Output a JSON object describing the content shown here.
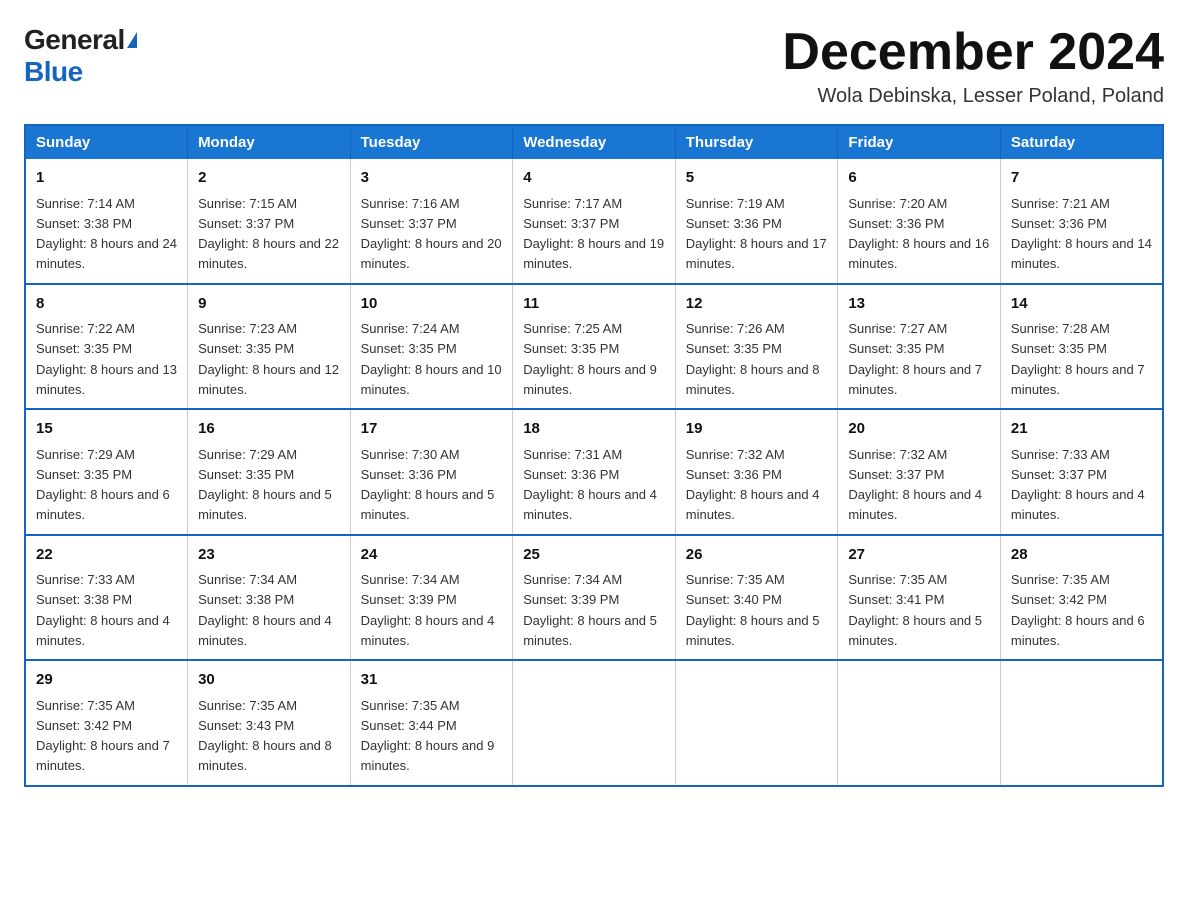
{
  "header": {
    "logo_general": "General",
    "logo_blue": "Blue",
    "month_title": "December 2024",
    "location": "Wola Debinska, Lesser Poland, Poland"
  },
  "days_of_week": [
    "Sunday",
    "Monday",
    "Tuesday",
    "Wednesday",
    "Thursday",
    "Friday",
    "Saturday"
  ],
  "weeks": [
    [
      {
        "day": "1",
        "sunrise": "7:14 AM",
        "sunset": "3:38 PM",
        "daylight": "8 hours and 24 minutes."
      },
      {
        "day": "2",
        "sunrise": "7:15 AM",
        "sunset": "3:37 PM",
        "daylight": "8 hours and 22 minutes."
      },
      {
        "day": "3",
        "sunrise": "7:16 AM",
        "sunset": "3:37 PM",
        "daylight": "8 hours and 20 minutes."
      },
      {
        "day": "4",
        "sunrise": "7:17 AM",
        "sunset": "3:37 PM",
        "daylight": "8 hours and 19 minutes."
      },
      {
        "day": "5",
        "sunrise": "7:19 AM",
        "sunset": "3:36 PM",
        "daylight": "8 hours and 17 minutes."
      },
      {
        "day": "6",
        "sunrise": "7:20 AM",
        "sunset": "3:36 PM",
        "daylight": "8 hours and 16 minutes."
      },
      {
        "day": "7",
        "sunrise": "7:21 AM",
        "sunset": "3:36 PM",
        "daylight": "8 hours and 14 minutes."
      }
    ],
    [
      {
        "day": "8",
        "sunrise": "7:22 AM",
        "sunset": "3:35 PM",
        "daylight": "8 hours and 13 minutes."
      },
      {
        "day": "9",
        "sunrise": "7:23 AM",
        "sunset": "3:35 PM",
        "daylight": "8 hours and 12 minutes."
      },
      {
        "day": "10",
        "sunrise": "7:24 AM",
        "sunset": "3:35 PM",
        "daylight": "8 hours and 10 minutes."
      },
      {
        "day": "11",
        "sunrise": "7:25 AM",
        "sunset": "3:35 PM",
        "daylight": "8 hours and 9 minutes."
      },
      {
        "day": "12",
        "sunrise": "7:26 AM",
        "sunset": "3:35 PM",
        "daylight": "8 hours and 8 minutes."
      },
      {
        "day": "13",
        "sunrise": "7:27 AM",
        "sunset": "3:35 PM",
        "daylight": "8 hours and 7 minutes."
      },
      {
        "day": "14",
        "sunrise": "7:28 AM",
        "sunset": "3:35 PM",
        "daylight": "8 hours and 7 minutes."
      }
    ],
    [
      {
        "day": "15",
        "sunrise": "7:29 AM",
        "sunset": "3:35 PM",
        "daylight": "8 hours and 6 minutes."
      },
      {
        "day": "16",
        "sunrise": "7:29 AM",
        "sunset": "3:35 PM",
        "daylight": "8 hours and 5 minutes."
      },
      {
        "day": "17",
        "sunrise": "7:30 AM",
        "sunset": "3:36 PM",
        "daylight": "8 hours and 5 minutes."
      },
      {
        "day": "18",
        "sunrise": "7:31 AM",
        "sunset": "3:36 PM",
        "daylight": "8 hours and 4 minutes."
      },
      {
        "day": "19",
        "sunrise": "7:32 AM",
        "sunset": "3:36 PM",
        "daylight": "8 hours and 4 minutes."
      },
      {
        "day": "20",
        "sunrise": "7:32 AM",
        "sunset": "3:37 PM",
        "daylight": "8 hours and 4 minutes."
      },
      {
        "day": "21",
        "sunrise": "7:33 AM",
        "sunset": "3:37 PM",
        "daylight": "8 hours and 4 minutes."
      }
    ],
    [
      {
        "day": "22",
        "sunrise": "7:33 AM",
        "sunset": "3:38 PM",
        "daylight": "8 hours and 4 minutes."
      },
      {
        "day": "23",
        "sunrise": "7:34 AM",
        "sunset": "3:38 PM",
        "daylight": "8 hours and 4 minutes."
      },
      {
        "day": "24",
        "sunrise": "7:34 AM",
        "sunset": "3:39 PM",
        "daylight": "8 hours and 4 minutes."
      },
      {
        "day": "25",
        "sunrise": "7:34 AM",
        "sunset": "3:39 PM",
        "daylight": "8 hours and 5 minutes."
      },
      {
        "day": "26",
        "sunrise": "7:35 AM",
        "sunset": "3:40 PM",
        "daylight": "8 hours and 5 minutes."
      },
      {
        "day": "27",
        "sunrise": "7:35 AM",
        "sunset": "3:41 PM",
        "daylight": "8 hours and 5 minutes."
      },
      {
        "day": "28",
        "sunrise": "7:35 AM",
        "sunset": "3:42 PM",
        "daylight": "8 hours and 6 minutes."
      }
    ],
    [
      {
        "day": "29",
        "sunrise": "7:35 AM",
        "sunset": "3:42 PM",
        "daylight": "8 hours and 7 minutes."
      },
      {
        "day": "30",
        "sunrise": "7:35 AM",
        "sunset": "3:43 PM",
        "daylight": "8 hours and 8 minutes."
      },
      {
        "day": "31",
        "sunrise": "7:35 AM",
        "sunset": "3:44 PM",
        "daylight": "8 hours and 9 minutes."
      },
      null,
      null,
      null,
      null
    ]
  ]
}
